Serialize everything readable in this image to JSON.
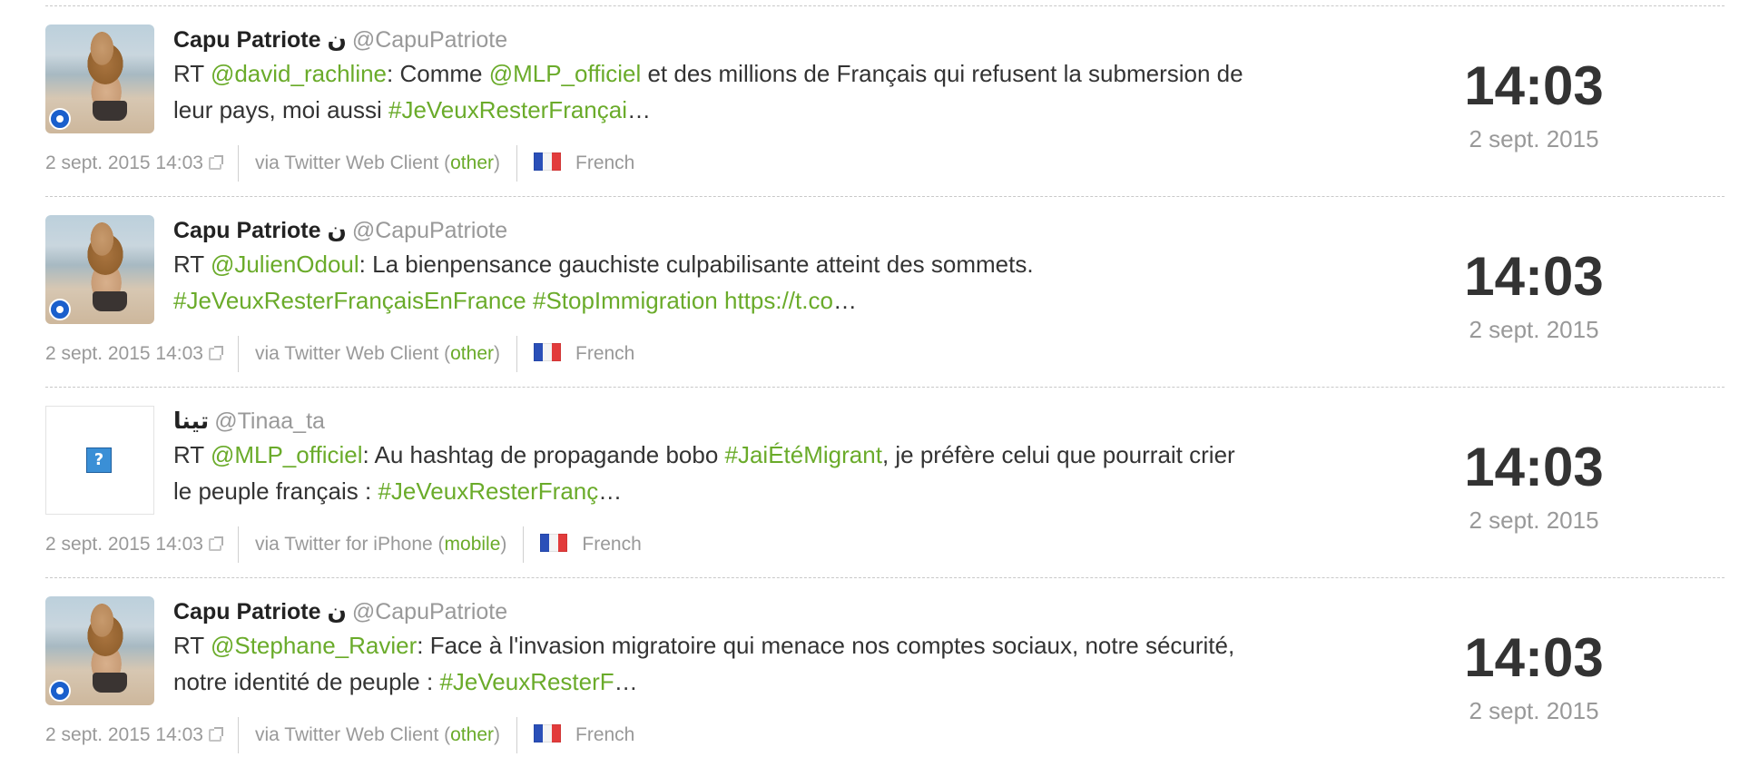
{
  "tweets": [
    {
      "name": "Capu Patriote ن",
      "handle": "@CapuPatriote",
      "avatar": "photo",
      "text_parts": [
        {
          "t": "RT ",
          "k": "plain"
        },
        {
          "t": "@david_rachline",
          "k": "mention"
        },
        {
          "t": ": Comme ",
          "k": "plain"
        },
        {
          "t": "@MLP_officiel",
          "k": "mention"
        },
        {
          "t": " et des millions de Français qui refusent la submersion de leur pays, moi aussi ",
          "k": "plain"
        },
        {
          "t": "#JeVeuxResterFrançai",
          "k": "tag"
        },
        {
          "t": "…",
          "k": "plain"
        }
      ],
      "timestamp": "2 sept. 2015 14:03",
      "via_prefix": "via Twitter Web Client (",
      "via_kind": "other",
      "via_suffix": ")",
      "language": "French",
      "time_big": "14:03",
      "date_small": "2 sept. 2015"
    },
    {
      "name": "Capu Patriote ن",
      "handle": "@CapuPatriote",
      "avatar": "photo",
      "text_parts": [
        {
          "t": "RT ",
          "k": "plain"
        },
        {
          "t": "@JulienOdoul",
          "k": "mention"
        },
        {
          "t": ": La bienpensance gauchiste culpabilisante atteint des sommets. ",
          "k": "plain"
        },
        {
          "t": "#JeVeuxResterFrançaisEnFrance",
          "k": "tag"
        },
        {
          "t": " ",
          "k": "plain"
        },
        {
          "t": "#StopImmigration",
          "k": "tag"
        },
        {
          "t": " ",
          "k": "plain"
        },
        {
          "t": "https://t.co",
          "k": "link"
        },
        {
          "t": "…",
          "k": "plain"
        }
      ],
      "timestamp": "2 sept. 2015 14:03",
      "via_prefix": "via Twitter Web Client (",
      "via_kind": "other",
      "via_suffix": ")",
      "language": "French",
      "time_big": "14:03",
      "date_small": "2 sept. 2015"
    },
    {
      "name": "تينا",
      "handle": "@Tinaa_ta",
      "avatar": "placeholder",
      "avatar_glyph": "?",
      "text_parts": [
        {
          "t": "RT ",
          "k": "plain"
        },
        {
          "t": "@MLP_officiel",
          "k": "mention"
        },
        {
          "t": ": Au hashtag de propagande bobo ",
          "k": "plain"
        },
        {
          "t": "#JaiÉtéMigrant",
          "k": "tag"
        },
        {
          "t": ", je préfère celui que pourrait crier le peuple français : ",
          "k": "plain"
        },
        {
          "t": "#JeVeuxResterFranç",
          "k": "tag"
        },
        {
          "t": "…",
          "k": "plain"
        }
      ],
      "timestamp": "2 sept. 2015 14:03",
      "via_prefix": "via Twitter for iPhone (",
      "via_kind": "mobile",
      "via_suffix": ")",
      "language": "French",
      "time_big": "14:03",
      "date_small": "2 sept. 2015"
    },
    {
      "name": "Capu Patriote ن",
      "handle": "@CapuPatriote",
      "avatar": "photo",
      "text_parts": [
        {
          "t": "RT ",
          "k": "plain"
        },
        {
          "t": "@Stephane_Ravier",
          "k": "mention"
        },
        {
          "t": ": Face à l'invasion migratoire qui menace nos comptes sociaux, notre sécurité, notre identité de peuple : ",
          "k": "plain"
        },
        {
          "t": "#JeVeuxResterF",
          "k": "tag"
        },
        {
          "t": "…",
          "k": "plain"
        }
      ],
      "timestamp": "2 sept. 2015 14:03",
      "via_prefix": "via Twitter Web Client (",
      "via_kind": "other",
      "via_suffix": ")",
      "language": "French",
      "time_big": "14:03",
      "date_small": "2 sept. 2015"
    }
  ],
  "icons": {
    "external_link": "external-link-icon",
    "flag": "france-flag-icon",
    "avatar_badge": "badge-icon",
    "placeholder": "question-mark-icon"
  },
  "colors": {
    "link_green": "#6aab2a",
    "muted_gray": "#999999",
    "text_dark": "#333333",
    "separator": "#c8c8c8"
  }
}
